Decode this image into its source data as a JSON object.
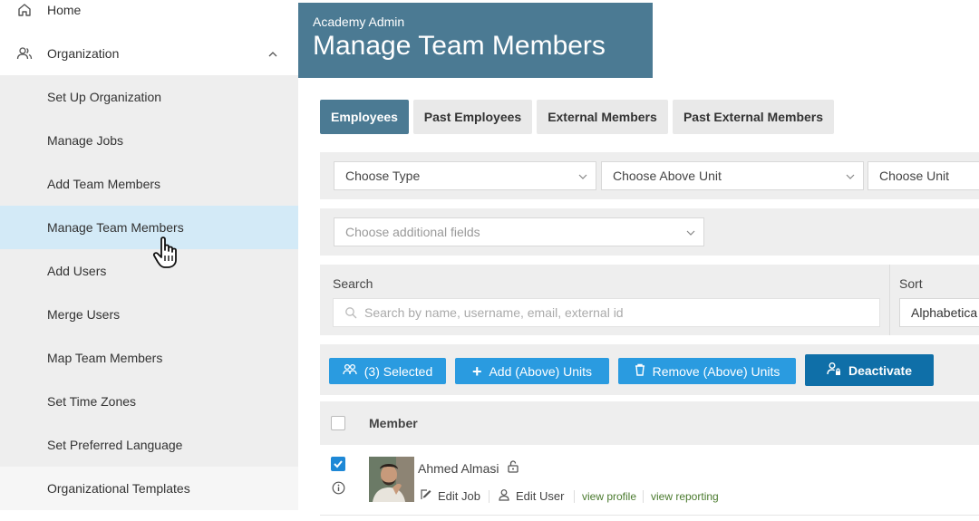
{
  "sidebar": {
    "home": "Home",
    "organization": "Organization",
    "items": [
      {
        "label": "Set Up Organization"
      },
      {
        "label": "Manage Jobs"
      },
      {
        "label": "Add Team Members"
      },
      {
        "label": "Manage Team Members"
      },
      {
        "label": "Add Users"
      },
      {
        "label": "Merge Users"
      },
      {
        "label": "Map Team Members"
      },
      {
        "label": "Set Time Zones"
      },
      {
        "label": "Set Preferred Language"
      },
      {
        "label": "Organizational Templates"
      }
    ]
  },
  "header": {
    "subtitle": "Academy Admin",
    "title": "Manage Team Members"
  },
  "tabs": [
    {
      "label": "Employees"
    },
    {
      "label": "Past Employees"
    },
    {
      "label": "External Members"
    },
    {
      "label": "Past External Members"
    }
  ],
  "filters": {
    "type": "Choose Type",
    "above_unit": "Choose Above Unit",
    "unit": "Choose Unit",
    "additional_fields": "Choose additional fields"
  },
  "search": {
    "label": "Search",
    "placeholder": "Search by name, username, email, external id",
    "sort_label": "Sort",
    "sort_value": "Alphabetica"
  },
  "actions": {
    "selected": "(3) Selected",
    "add_units": "Add (Above) Units",
    "remove_units": "Remove (Above) Units",
    "deactivate": "Deactivate"
  },
  "table": {
    "header_member": "Member",
    "rows": [
      {
        "name": "Ahmed Almasi",
        "edit_job": "Edit Job",
        "edit_user": "Edit User",
        "view_profile": "view profile",
        "view_reporting": "view reporting"
      }
    ]
  },
  "colors": {
    "accent": "#4b7a93",
    "action_blue": "#2a9be0",
    "deactivate_blue": "#0f6fa8",
    "active_nav": "#d3eaf7"
  }
}
